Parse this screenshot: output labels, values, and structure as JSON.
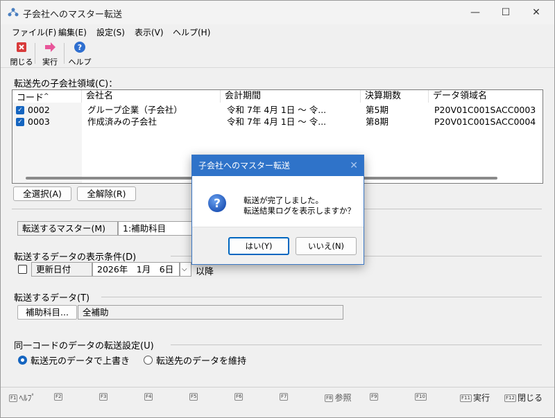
{
  "window": {
    "title": "子会社へのマスター転送",
    "controls": {
      "minimize": "—",
      "maximize": "☐",
      "close": "✕"
    }
  },
  "menu": [
    "ファイル(F)",
    "編集(E)",
    "設定(S)",
    "表示(V)",
    "ヘルプ(H)"
  ],
  "toolbar": {
    "close_label": "閉じる",
    "run_label": "実行",
    "help_label": "ヘルプ"
  },
  "dest_area_label": "転送先の子会社領域(C)：",
  "table": {
    "columns": [
      "コード",
      "会社名",
      "会計期間",
      "決算期数",
      "データ領域名"
    ],
    "rows": [
      {
        "code": "0002",
        "name": "グループ企業（子会社）",
        "period": "令和 7年 4月 1日 ～ 令...",
        "fiscal": "第5期",
        "area": "P20V01C001SACC0003"
      },
      {
        "code": "0003",
        "name": "作成済みの子会社",
        "period": "令和 7年 4月 1日 ～ 令...",
        "fiscal": "第8期",
        "area": "P20V01C001SACC0004"
      }
    ]
  },
  "buttons": {
    "select_all": "全選択(A)",
    "deselect_all": "全解除(R)",
    "sub_account": "補助科目..."
  },
  "master": {
    "label": "転送するマスター(M)",
    "value": "1:補助科目"
  },
  "condition": {
    "label": "転送するデータの表示条件(D)",
    "field": "更新日付",
    "date": "2026年　1月　6日",
    "suffix": "以降"
  },
  "data_to_transfer": {
    "label": "転送するデータ(T)",
    "value": "全補助"
  },
  "same_code": {
    "label": "同一コードのデータの転送設定(U)",
    "option1": "転送元のデータで上書き",
    "option2": "転送先のデータを維持"
  },
  "statusbar": [
    {
      "key": "F1",
      "label": "ﾍﾙﾌﾟ"
    },
    {
      "key": "F2",
      "label": ""
    },
    {
      "key": "F3",
      "label": ""
    },
    {
      "key": "F4",
      "label": ""
    },
    {
      "key": "F5",
      "label": ""
    },
    {
      "key": "F6",
      "label": ""
    },
    {
      "key": "F7",
      "label": ""
    },
    {
      "key": "F8",
      "label": "参照"
    },
    {
      "key": "F9",
      "label": ""
    },
    {
      "key": "F10",
      "label": ""
    },
    {
      "key": "F11",
      "label": "実行"
    },
    {
      "key": "F12",
      "label": "閉じる"
    }
  ],
  "dialog": {
    "title": "子会社へのマスター転送",
    "close": "✕",
    "message_line1": "転送が完了しました。",
    "message_line2": "転送結果ログを表示しますか？",
    "yes": "はい(Y)",
    "no": "いいえ(N)"
  },
  "colors": {
    "accent": "#1565c0",
    "dialog_title_bg": "#2f73c9"
  }
}
